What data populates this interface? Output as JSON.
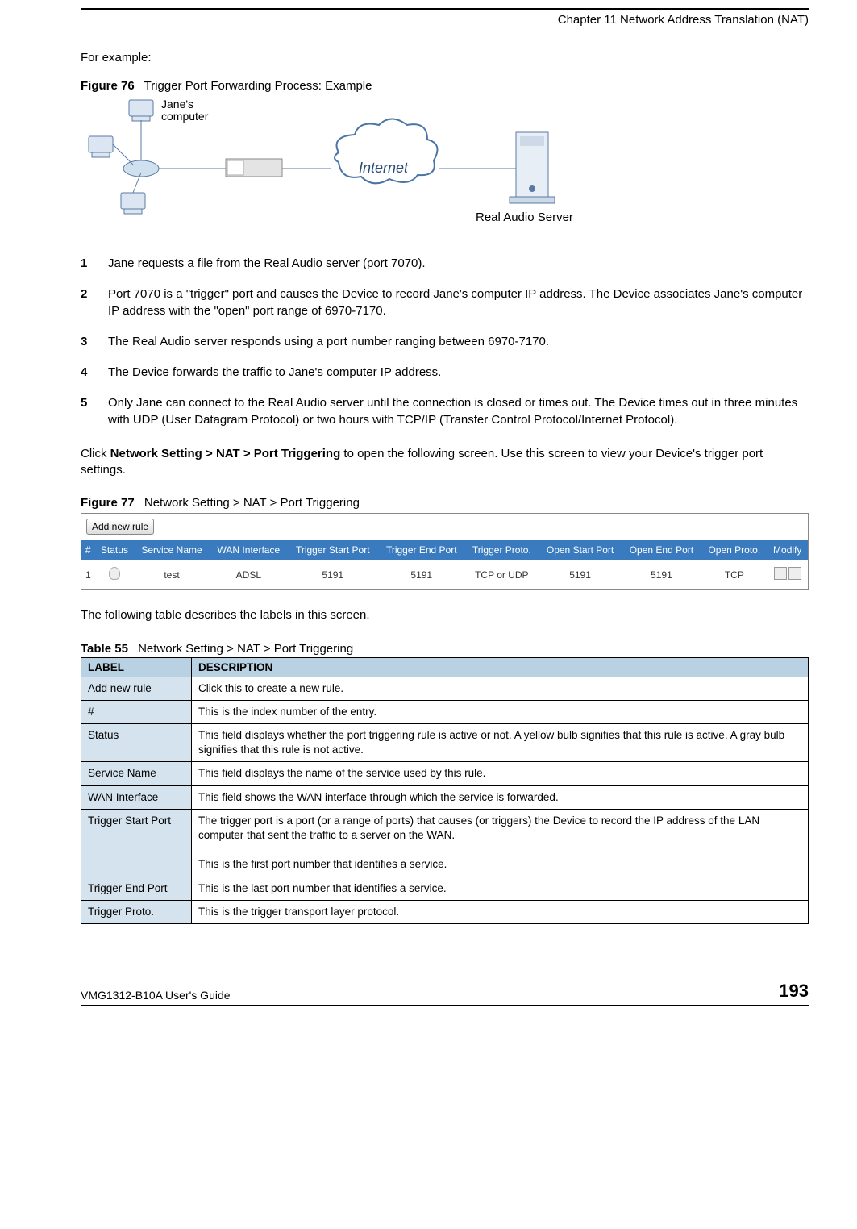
{
  "header": {
    "chapter": "Chapter 11 Network Address Translation (NAT)"
  },
  "intro": "For example:",
  "figure76": {
    "label": "Figure 76",
    "title": "Trigger Port Forwarding Process: Example",
    "janes_label": "Jane's\ncomputer",
    "internet_label": "Internet",
    "server_label": "Real Audio Server"
  },
  "steps": [
    {
      "n": "1",
      "t": "Jane requests a file from the Real Audio server (port 7070)."
    },
    {
      "n": "2",
      "t": "Port 7070 is a \"trigger\" port and causes the Device to record Jane's computer IP address. The Device associates Jane's computer IP address with the \"open\" port range of 6970-7170."
    },
    {
      "n": "3",
      "t": "The Real Audio server responds using a port number ranging between 6970-7170."
    },
    {
      "n": "4",
      "t": "The Device forwards the traffic to Jane's computer IP address."
    },
    {
      "n": "5",
      "t": "Only Jane can connect to the Real Audio server until the connection is closed or times out. The Device times out in three minutes with UDP (User Datagram Protocol) or two hours with TCP/IP (Transfer Control Protocol/Internet Protocol)."
    }
  ],
  "click_para": {
    "pre": "Click ",
    "bold": "Network Setting > NAT > Port Triggering",
    "post": " to open the following screen. Use this screen to view your Device's trigger port settings."
  },
  "figure77": {
    "label": "Figure 77",
    "title": "Network Setting > NAT > Port Triggering",
    "add_btn": "Add new rule",
    "headers": [
      "#",
      "Status",
      "Service Name",
      "WAN Interface",
      "Trigger Start Port",
      "Trigger End Port",
      "Trigger Proto.",
      "Open Start Port",
      "Open End Port",
      "Open Proto.",
      "Modify"
    ],
    "row": {
      "num": "1",
      "service": "test",
      "wan": "ADSL",
      "tsp": "5191",
      "tep": "5191",
      "tproto": "TCP or UDP",
      "osp": "5191",
      "oep": "5191",
      "oproto": "TCP"
    }
  },
  "table_intro": "The following table describes the labels in this screen.",
  "table55": {
    "label": "Table 55",
    "title": "Network Setting > NAT > Port Triggering",
    "head_label": "LABEL",
    "head_desc": "DESCRIPTION",
    "rows": [
      {
        "l": "Add new rule",
        "d": "Click this to create a new rule."
      },
      {
        "l": "#",
        "d": "This is the index number of the entry."
      },
      {
        "l": "Status",
        "d": "This field displays whether the port triggering rule is active or not. A yellow bulb signifies that this rule is active. A gray bulb signifies that this rule is not active."
      },
      {
        "l": "Service Name",
        "d": "This field displays the name of the service used by this rule."
      },
      {
        "l": "WAN Interface",
        "d": "This field shows the WAN interface through which the service is forwarded."
      },
      {
        "l": "Trigger Start Port",
        "d": "The trigger port is a port (or a range of ports) that causes (or triggers) the Device to record the IP address of the LAN computer that sent the traffic to a server on the WAN.\n\nThis is the first port number that identifies a service."
      },
      {
        "l": "Trigger End Port",
        "d": "This is the last port number that identifies a service."
      },
      {
        "l": "Trigger Proto.",
        "d": "This is the trigger transport layer protocol."
      }
    ]
  },
  "footer": {
    "guide": "VMG1312-B10A User's Guide",
    "page": "193"
  }
}
